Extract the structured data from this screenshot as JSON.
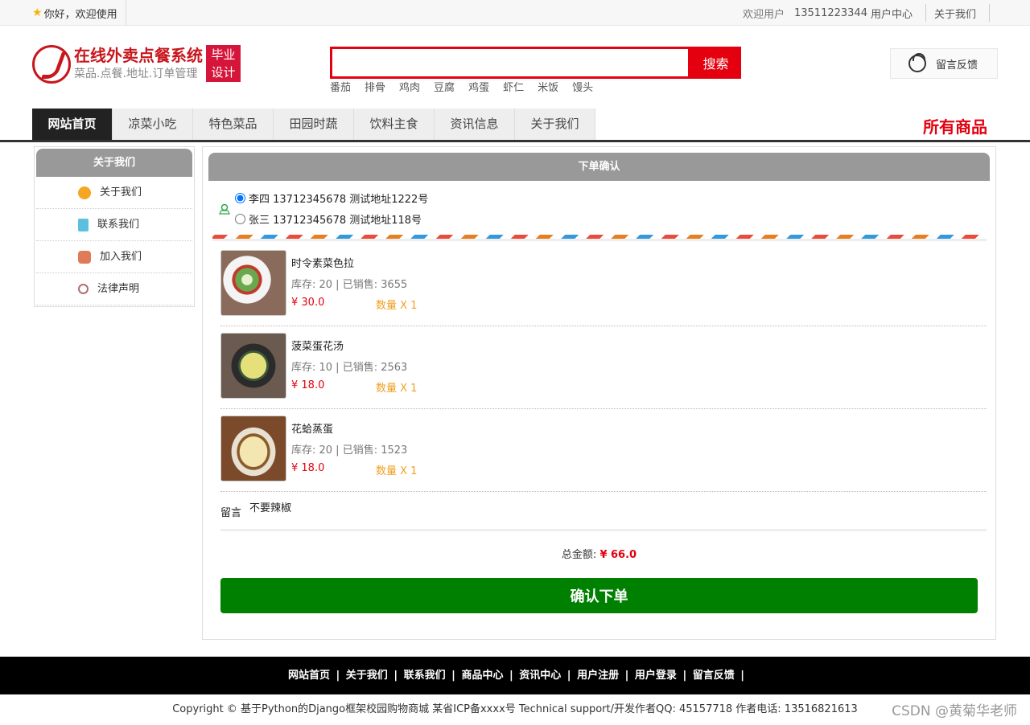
{
  "topbar": {
    "greeting": "你好，欢迎使用",
    "welcome": "欢迎用户",
    "user_phone": "13511223344",
    "user_center": "用户中心",
    "about": "关于我们"
  },
  "logo": {
    "title": "在线外卖点餐系统",
    "subtitle": "菜品.点餐.地址.订单管理",
    "badge_line1": "毕业",
    "badge_line2": "设计"
  },
  "search": {
    "placeholder": "",
    "button": "搜索",
    "hotwords": [
      "番茄",
      "排骨",
      "鸡肉",
      "豆腐",
      "鸡蛋",
      "虾仁",
      "米饭",
      "馒头"
    ]
  },
  "feedback": "留言反馈",
  "nav": {
    "items": [
      "网站首页",
      "凉菜小吃",
      "特色菜品",
      "田园时蔬",
      "饮料主食",
      "资讯信息",
      "关于我们"
    ],
    "all_goods": "所有商品"
  },
  "sidebar": {
    "title": "关于我们",
    "items": [
      "关于我们",
      "联系我们",
      "加入我们",
      "法律声明"
    ]
  },
  "order": {
    "title": "下单确认",
    "addresses": [
      "李四 13712345678 测试地址1222号",
      "张三 13712345678 测试地址118号"
    ],
    "products": [
      {
        "name": "时令素菜色拉",
        "stock": "库存:   20 | 已销售:   3655",
        "price": "¥ 30.0",
        "qty": "数量 X 1"
      },
      {
        "name": "菠菜蛋花汤",
        "stock": "库存:   10 | 已销售:   2563",
        "price": "¥ 18.0",
        "qty": "数量 X 1"
      },
      {
        "name": "花蛤蒸蛋",
        "stock": "库存:   20 | 已销售:   1523",
        "price": "¥ 18.0",
        "qty": "数量 X 1"
      }
    ],
    "note_label": "留言",
    "note_value": "不要辣椒",
    "total_label": "总金额:",
    "total_value": "¥ 66.0",
    "confirm_button": "确认下单"
  },
  "footer": {
    "links": [
      "网站首页",
      "关于我们",
      "联系我们",
      "商品中心",
      "资讯中心",
      "用户注册",
      "用户登录",
      "留言反馈"
    ],
    "copyright": "Copyright © 基于Python的Django框架校园购物商城 某省ICP备xxxx号    Technical support/开发作者QQ:  45157718    作者电话: 13516821613",
    "watermark": "CSDN @黄菊华老师"
  },
  "colors": {
    "brand_red": "#e4000e",
    "confirm_green": "#008000",
    "header_gray": "#999999"
  }
}
